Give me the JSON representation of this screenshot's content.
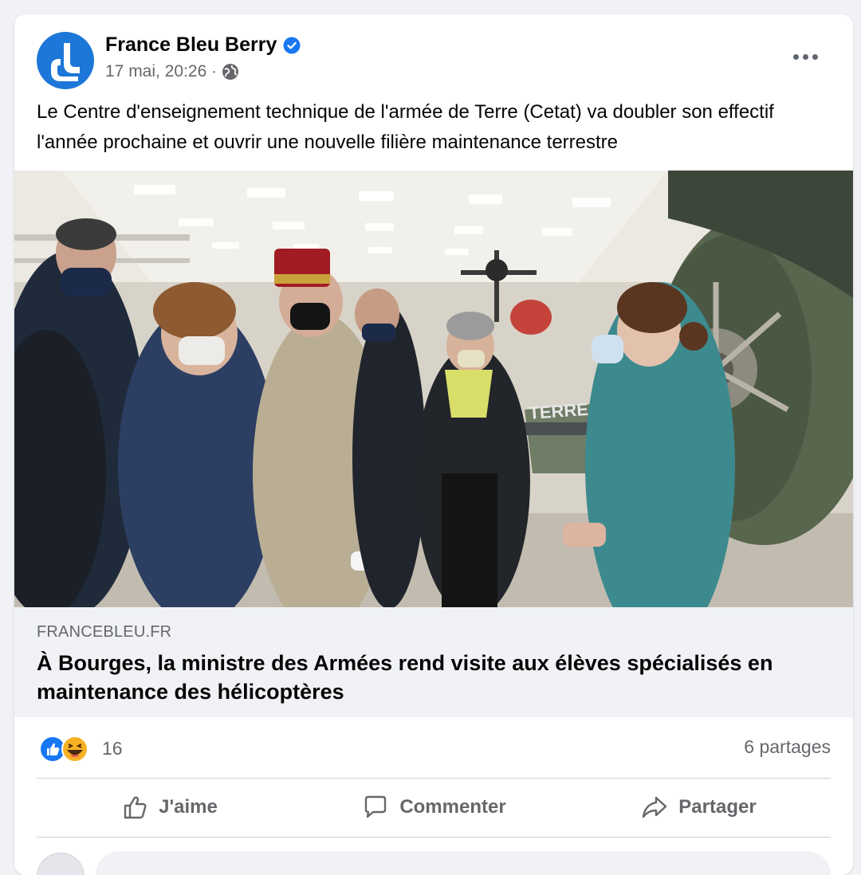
{
  "post": {
    "page_name": "France Bleu Berry",
    "timestamp": "17 mai, 20:26 ·",
    "text": "Le Centre d'enseignement technique de l'armée de Terre (Cetat) va doubler son effectif l'année prochaine et ouvrir une nouvelle filière maintenance terrestre",
    "photo_text": "TERRE",
    "icons": {
      "avatar": "france-bleu-logo",
      "verified": "verified-badge-icon",
      "privacy": "globe-icon",
      "menu": "more-options-icon"
    }
  },
  "link_preview": {
    "domain": "FRANCEBLEU.FR",
    "title": "À Bourges, la ministre des Armées rend visite aux élèves spécialisés en maintenance des hélicoptères"
  },
  "engagement": {
    "reaction_icons": [
      "like-reaction-icon",
      "haha-reaction-icon"
    ],
    "reaction_count": "16",
    "shares": "6 partages"
  },
  "actions": {
    "like": "J'aime",
    "comment": "Commenter",
    "share": "Partager"
  },
  "colors": {
    "brand_blue": "#1c77d8",
    "verified_blue": "#1877f2",
    "text_secondary": "#65676b",
    "background": "#f0f2f5"
  }
}
